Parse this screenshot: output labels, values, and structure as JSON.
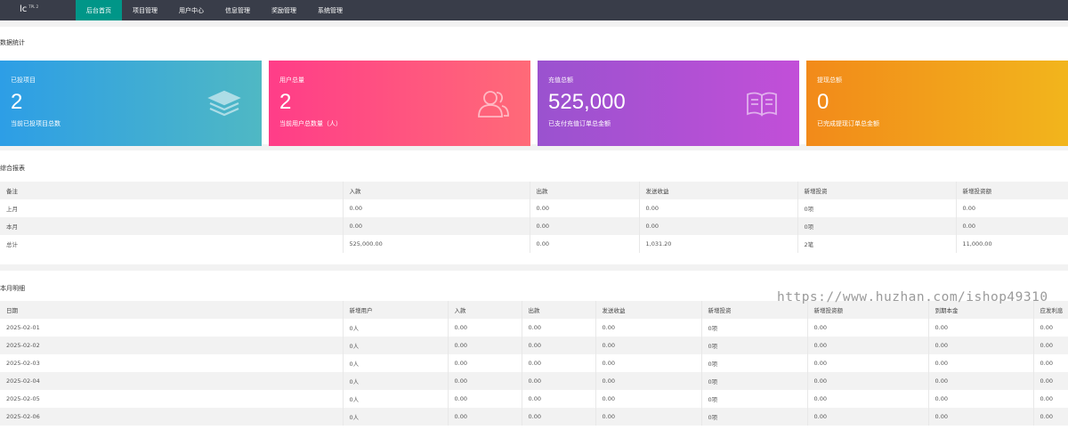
{
  "nav": {
    "logo": "lc",
    "version": "TPL 2",
    "items": [
      "后台首页",
      "项目管理",
      "用户中心",
      "信息管理",
      "奖励管理",
      "系统管理"
    ],
    "active_index": 0
  },
  "stats": {
    "title": "数据统计",
    "cards": [
      {
        "label": "已投项目",
        "value": "2",
        "desc": "当前已投项目总数",
        "icon": "layers-icon"
      },
      {
        "label": "用户总量",
        "value": "2",
        "desc": "当前用户总数量（人）",
        "icon": "users-icon"
      },
      {
        "label": "充值总额",
        "value": "525,000",
        "desc": "已支付充值订单总金额",
        "icon": "book-icon"
      },
      {
        "label": "提现总额",
        "value": "0",
        "desc": "已完成提现订单总金额",
        "icon": ""
      }
    ]
  },
  "report": {
    "title": "综合报表",
    "columns": [
      "备注",
      "入款",
      "出款",
      "发送收益",
      "新增投资",
      "新增投资额"
    ],
    "rows": [
      [
        "上月",
        "0.00",
        "0.00",
        "0.00",
        "0项",
        "0.00"
      ],
      [
        "本月",
        "0.00",
        "0.00",
        "0.00",
        "0项",
        "0.00"
      ],
      [
        "总计",
        "525,000.00",
        "0.00",
        "1,031.20",
        "2笔",
        "11,000.00"
      ]
    ]
  },
  "monthly": {
    "title": "本月明细",
    "columns": [
      "日期",
      "新增用户",
      "入款",
      "出款",
      "发送收益",
      "新增投资",
      "新增投资额",
      "到期本金",
      "应发利息"
    ],
    "rows": [
      [
        "2025-02-01",
        "0人",
        "0.00",
        "0.00",
        "0.00",
        "0项",
        "0.00",
        "0.00",
        "0.00"
      ],
      [
        "2025-02-02",
        "0人",
        "0.00",
        "0.00",
        "0.00",
        "0项",
        "0.00",
        "0.00",
        "0.00"
      ],
      [
        "2025-02-03",
        "0人",
        "0.00",
        "0.00",
        "0.00",
        "0项",
        "0.00",
        "0.00",
        "0.00"
      ],
      [
        "2025-02-04",
        "0人",
        "0.00",
        "0.00",
        "0.00",
        "0项",
        "0.00",
        "0.00",
        "0.00"
      ],
      [
        "2025-02-05",
        "0人",
        "0.00",
        "0.00",
        "0.00",
        "0项",
        "0.00",
        "0.00",
        "0.00"
      ],
      [
        "2025-02-06",
        "0人",
        "0.00",
        "0.00",
        "0.00",
        "0项",
        "0.00",
        "0.00",
        "0.00"
      ]
    ]
  },
  "watermark": "https://www.huzhan.com/ishop49310"
}
